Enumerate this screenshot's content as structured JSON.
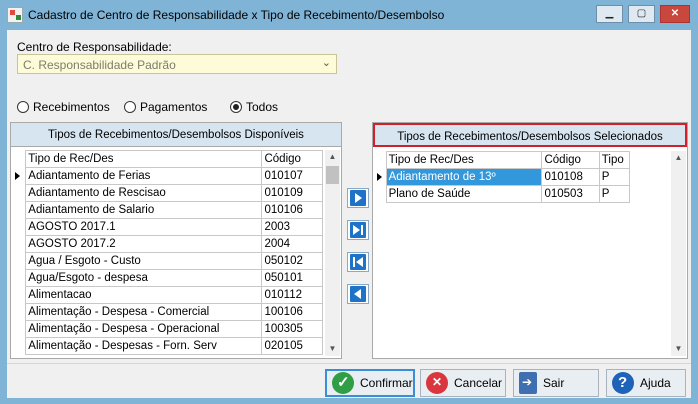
{
  "window": {
    "title": "Cadastro de Centro de Responsabilidade x Tipo de Recebimento/Desembolso",
    "controls": {
      "minimize": "▁",
      "maximize": "▢",
      "close": "✕"
    }
  },
  "responsabilidade": {
    "label": "Centro de Responsabilidade:",
    "value": "C. Responsabilidade Padrão"
  },
  "filter": {
    "options": [
      {
        "label": "Recebimentos",
        "checked": false
      },
      {
        "label": "Pagamentos",
        "checked": false
      },
      {
        "label": "Todos",
        "checked": true
      }
    ]
  },
  "disponiveis": {
    "header": "Tipos de Recebimentos/Desembolsos Disponíveis",
    "columns": [
      "Tipo de Rec/Des",
      "Código"
    ],
    "rows": [
      [
        "Adiantamento de Ferias",
        "010107"
      ],
      [
        "Adiantamento de Rescisao",
        "010109"
      ],
      [
        "Adiantamento de Salario",
        "010106"
      ],
      [
        "AGOSTO 2017.1",
        "2003"
      ],
      [
        "AGOSTO 2017.2",
        "2004"
      ],
      [
        "Agua / Esgoto - Custo",
        "050102"
      ],
      [
        "Agua/Esgoto - despesa",
        "050101"
      ],
      [
        "Alimentacao",
        "010112"
      ],
      [
        "Alimentação - Despesa - Comercial",
        "100106"
      ],
      [
        "Alimentação - Despesa - Operacional",
        "100305"
      ],
      [
        "Alimentação - Despesas - Forn. Serv",
        "020105"
      ]
    ]
  },
  "selecionados": {
    "header": "Tipos de Recebimentos/Desembolsos Selecionados",
    "columns": [
      "Tipo de Rec/Des",
      "Código",
      "Tipo"
    ],
    "rows": [
      [
        "Adiantamento de 13º",
        "010108",
        "P"
      ],
      [
        "Plano de Saúde",
        "010503",
        "P"
      ]
    ]
  },
  "buttons": {
    "confirmar": "Confirmar",
    "cancelar": "Cancelar",
    "sair": "Sair",
    "ajuda": "Ajuda"
  },
  "icons": {
    "scroll_up": "▲",
    "scroll_down": "▼",
    "dropdown": "⌄"
  }
}
